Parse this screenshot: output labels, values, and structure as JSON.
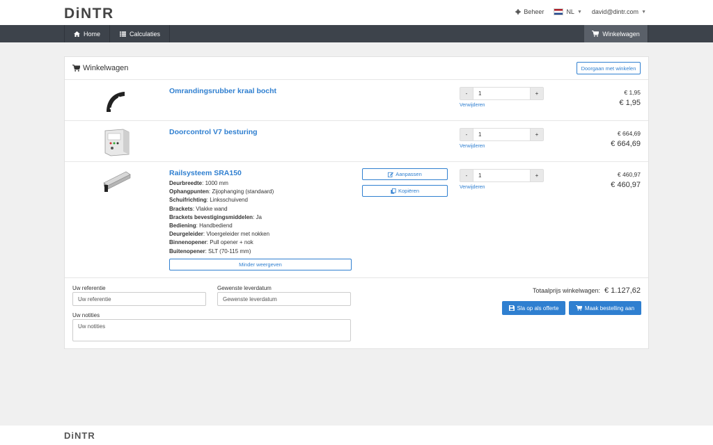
{
  "header": {
    "logo": "DiNTR",
    "admin_label": "Beheer",
    "language": "NL",
    "user_email": "david@dintr.com"
  },
  "nav": {
    "home": "Home",
    "calculations": "Calculaties",
    "cart": "Winkelwagen"
  },
  "cart": {
    "title": "Winkelwagen",
    "continue_label": "Doorgaan met winkelen",
    "remove_label": "Verwijderen",
    "items": [
      {
        "name": "Omrandingsrubber kraal bocht",
        "quantity": "1",
        "unit_price": "€ 1,95",
        "total": "€ 1,95"
      },
      {
        "name": "Doorcontrol V7 besturing",
        "quantity": "1",
        "unit_price": "€ 664,69",
        "total": "€ 664,69"
      },
      {
        "name": "Railsysteem SRA150",
        "quantity": "1",
        "unit_price": "€ 460,97",
        "total": "€ 460,97",
        "edit_label": "Aanpassen",
        "copy_label": "Kopiëren",
        "less_label": "Minder weergeven",
        "specs": [
          {
            "key": "Deurbreedte",
            "value": "1000 mm"
          },
          {
            "key": "Ophangpunten",
            "value": "Zijophanging (standaard)"
          },
          {
            "key": "Schuifrichting",
            "value": "Linksschuivend"
          },
          {
            "key": "Brackets",
            "value": "Vlakke wand"
          },
          {
            "key": "Brackets bevestigingsmiddelen",
            "value": "Ja"
          },
          {
            "key": "Bediening",
            "value": "Handbediend"
          },
          {
            "key": "Deurgeleider",
            "value": "Vloergeleider met nokken"
          },
          {
            "key": "Binnenopener",
            "value": "Pull opener + nok"
          },
          {
            "key": "Buitenopener",
            "value": "SLT (70-115 mm)"
          }
        ]
      }
    ],
    "form": {
      "reference_label": "Uw referentie",
      "reference_placeholder": "Uw referentie",
      "delivery_label": "Gewenste leverdatum",
      "delivery_placeholder": "Gewenste leverdatum",
      "notes_label": "Uw notities",
      "notes_placeholder": "Uw notities"
    },
    "total_label": "Totaalprijs winkelwagen:",
    "total_amount": "€ 1.127,62",
    "save_quote_label": "Sla op als offerte",
    "order_label": "Maak bestelling aan"
  },
  "footer": {
    "logo": "DiNTR"
  },
  "colors": {
    "accent": "#2f7fd0",
    "navbar": "#3d434b",
    "nav_active": "#5a6069"
  }
}
